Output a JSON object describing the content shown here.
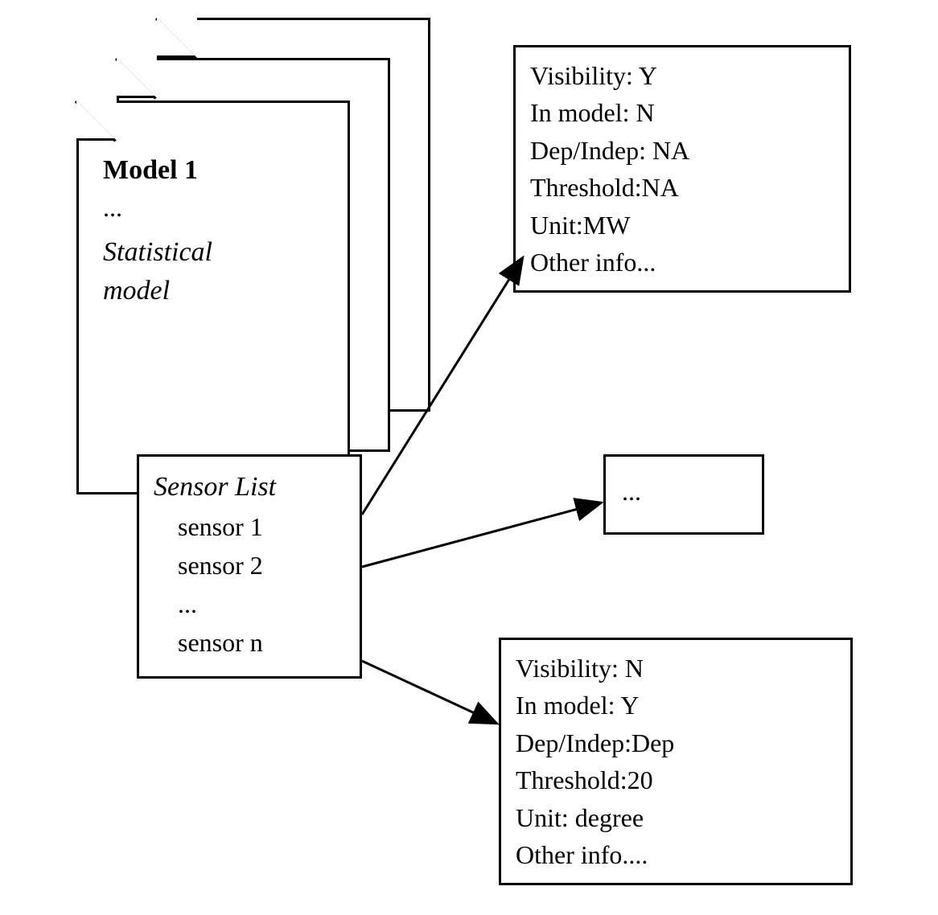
{
  "model": {
    "title": "Model 1",
    "ellipsis": "...",
    "statistical_line1": "Statistical",
    "statistical_line2": "model"
  },
  "sensor_list": {
    "title": "Sensor List",
    "items": [
      "sensor 1",
      "sensor 2",
      "...",
      "sensor n"
    ]
  },
  "info_box_1": {
    "visibility": "Visibility: Y",
    "in_model": "In model: N",
    "dep_indep": "Dep/Indep: NA",
    "threshold": "Threshold:NA",
    "unit": "Unit:MW",
    "other": "Other info..."
  },
  "info_box_2": {
    "ellipsis": "..."
  },
  "info_box_3": {
    "visibility": "Visibility: N",
    "in_model": "In model: Y",
    "dep_indep": "Dep/Indep:Dep",
    "threshold": "Threshold:20",
    "unit": "Unit: degree",
    "other": "Other info...."
  }
}
